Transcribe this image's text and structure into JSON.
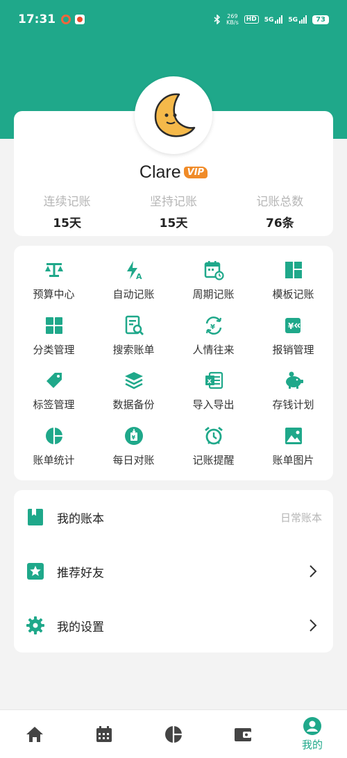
{
  "status_bar": {
    "time": "17:31",
    "net_speed_value": "269",
    "net_speed_unit": "KB/s",
    "hd": "HD",
    "sim1": "5G",
    "sim2": "5G",
    "battery": "73"
  },
  "profile": {
    "username": "Clare",
    "vip_label": "VIP",
    "stats": [
      {
        "label": "连续记账",
        "value": "15天"
      },
      {
        "label": "坚持记账",
        "value": "15天"
      },
      {
        "label": "记账总数",
        "value": "76条"
      }
    ]
  },
  "features": [
    {
      "label": "预算中心",
      "icon": "scale-icon"
    },
    {
      "label": "自动记账",
      "icon": "auto-bolt-icon"
    },
    {
      "label": "周期记账",
      "icon": "calendar-cycle-icon"
    },
    {
      "label": "模板记账",
      "icon": "template-icon"
    },
    {
      "label": "分类管理",
      "icon": "category-grid-icon"
    },
    {
      "label": "搜索账单",
      "icon": "search-bill-icon"
    },
    {
      "label": "人情往来",
      "icon": "yuan-exchange-icon"
    },
    {
      "label": "报销管理",
      "icon": "reimburse-icon"
    },
    {
      "label": "标签管理",
      "icon": "tag-icon"
    },
    {
      "label": "数据备份",
      "icon": "layers-icon"
    },
    {
      "label": "导入导出",
      "icon": "excel-icon"
    },
    {
      "label": "存钱计划",
      "icon": "piggy-bank-icon"
    },
    {
      "label": "账单统计",
      "icon": "pie-chart-icon"
    },
    {
      "label": "每日对账",
      "icon": "daily-check-icon"
    },
    {
      "label": "记账提醒",
      "icon": "alarm-clock-icon"
    },
    {
      "label": "账单图片",
      "icon": "image-icon"
    }
  ],
  "menu": {
    "my_books": {
      "label": "我的账本",
      "value": "日常账本"
    },
    "recommend": {
      "label": "推荐好友"
    },
    "settings": {
      "label": "我的设置"
    }
  },
  "tabbar": {
    "tabs": [
      "home",
      "calendar",
      "stats",
      "wallet",
      "mine"
    ],
    "active_label": "我的"
  },
  "colors": {
    "primary": "#1fa88a",
    "vip": "#f08b28",
    "avatar_moon": "#f5b94a"
  }
}
